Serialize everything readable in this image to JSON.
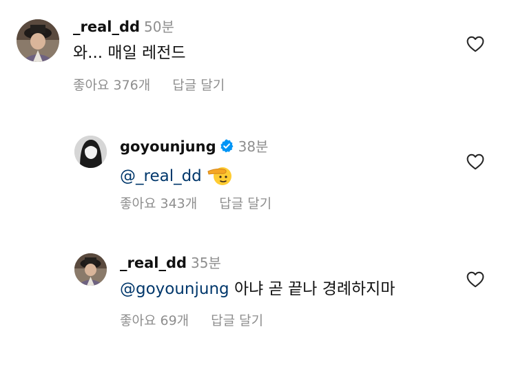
{
  "comments": [
    {
      "username": "_real_dd",
      "time": "50분",
      "text": "와... 매일 레전드",
      "likes": "좋아요 376개",
      "reply": "답글 달기",
      "avatar": "historical-costume-person-photo"
    },
    {
      "username": "goyounjung",
      "time": "38분",
      "mention": "@_real_dd",
      "text": "",
      "emoji": "saluting-face-emoji",
      "verified": true,
      "likes": "좋아요 343개",
      "reply": "답글 달기",
      "avatar": "black-and-white-portrait-photo"
    },
    {
      "username": "_real_dd",
      "time": "35분",
      "mention": "@goyounjung",
      "text": " 아냐 곧 끝나 경례하지마",
      "likes": "좋아요 69개",
      "reply": "답글 달기",
      "avatar": "historical-costume-person-photo"
    }
  ],
  "icons": {
    "like": "heart-outline-icon",
    "verified": "verified-badge-icon"
  },
  "colors": {
    "mention": "#00376b",
    "secondary_text": "#8e8e8e",
    "verified_blue": "#0095f6"
  }
}
